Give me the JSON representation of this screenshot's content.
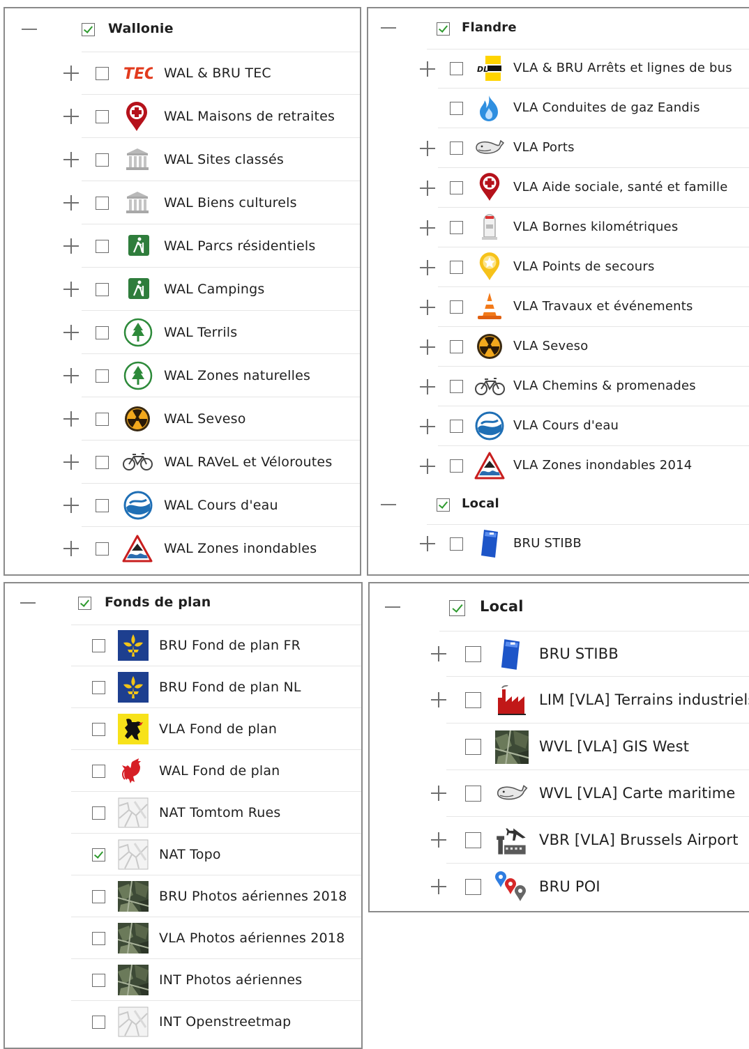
{
  "panels": {
    "wallonie": {
      "title": "Wallonie",
      "items": [
        {
          "label": "WAL & BRU TEC",
          "icon": "tec-logo-icon"
        },
        {
          "label": "WAL Maisons de retraites",
          "icon": "red-cross-marker-icon"
        },
        {
          "label": "WAL Sites classés",
          "icon": "monument-icon"
        },
        {
          "label": "WAL Biens culturels",
          "icon": "monument-icon"
        },
        {
          "label": "WAL Parcs résidentiels",
          "icon": "hiker-icon"
        },
        {
          "label": "WAL Campings",
          "icon": "hiker-icon"
        },
        {
          "label": "WAL Terrils",
          "icon": "tree-icon"
        },
        {
          "label": "WAL Zones naturelles",
          "icon": "tree-icon"
        },
        {
          "label": "WAL Seveso",
          "icon": "radiation-icon"
        },
        {
          "label": "WAL RAVeL et Véloroutes",
          "icon": "bicycle-icon"
        },
        {
          "label": "WAL Cours d'eau",
          "icon": "water-icon"
        },
        {
          "label": "WAL Zones inondables",
          "icon": "flood-warning-icon"
        }
      ]
    },
    "flandre": {
      "title": "Flandre",
      "items": [
        {
          "label": "VLA & BRU Arrêts et lignes de bus",
          "icon": "dl-bus-logo-icon",
          "expandable": true
        },
        {
          "label": "VLA Conduites de gaz Eandis",
          "icon": "gas-flame-icon",
          "expandable": false
        },
        {
          "label": "VLA Ports",
          "icon": "whale-icon",
          "expandable": true
        },
        {
          "label": "VLA Aide sociale, santé et famille",
          "icon": "red-cross-marker-icon",
          "expandable": true
        },
        {
          "label": "VLA Bornes kilométriques",
          "icon": "milestone-icon",
          "expandable": true
        },
        {
          "label": "VLA Points de secours",
          "icon": "rescue-point-icon",
          "expandable": true
        },
        {
          "label": "VLA Travaux et événements",
          "icon": "traffic-cone-icon",
          "expandable": true
        },
        {
          "label": "VLA Seveso",
          "icon": "radiation-icon",
          "expandable": true
        },
        {
          "label": "VLA Chemins & promenades",
          "icon": "bicycle-icon",
          "expandable": true
        },
        {
          "label": "VLA Cours d'eau",
          "icon": "water-icon",
          "expandable": true
        },
        {
          "label": "VLA Zones inondables 2014",
          "icon": "flood-warning-icon",
          "expandable": true
        }
      ],
      "local_title": "Local",
      "local_items": [
        {
          "label": "BRU STIBB",
          "icon": "stib-ticket-icon"
        }
      ]
    },
    "fonds": {
      "title": "Fonds de plan",
      "items": [
        {
          "label": "BRU Fond de plan FR",
          "icon": "brussels-iris-icon",
          "checked": false
        },
        {
          "label": "BRU Fond de plan NL",
          "icon": "brussels-iris-icon",
          "checked": false
        },
        {
          "label": "VLA Fond de plan",
          "icon": "flemish-lion-icon",
          "checked": false
        },
        {
          "label": "WAL Fond de plan",
          "icon": "walloon-rooster-icon",
          "checked": false
        },
        {
          "label": "NAT Tomtom Rues",
          "icon": "street-map-icon",
          "checked": false
        },
        {
          "label": "NAT Topo",
          "icon": "street-map-icon",
          "checked": true
        },
        {
          "label": "BRU Photos aériennes 2018",
          "icon": "aerial-photo-icon",
          "checked": false
        },
        {
          "label": "VLA Photos aériennes 2018",
          "icon": "aerial-photo-icon",
          "checked": false
        },
        {
          "label": "INT Photos aériennes",
          "icon": "aerial-photo-icon",
          "checked": false
        },
        {
          "label": "INT Openstreetmap",
          "icon": "street-map-icon",
          "checked": false
        }
      ]
    },
    "local": {
      "title": "Local",
      "items": [
        {
          "label": "BRU STIBB",
          "icon": "stib-ticket-icon",
          "expandable": true
        },
        {
          "label": "LIM [VLA] Terrains industriels",
          "icon": "factory-icon",
          "expandable": true
        },
        {
          "label": "WVL [VLA] GIS West",
          "icon": "aerial-photo-icon",
          "expandable": false
        },
        {
          "label": "WVL [VLA] Carte maritime",
          "icon": "whale-icon",
          "expandable": true
        },
        {
          "label": "VBR [VLA] Brussels Airport",
          "icon": "airport-icon",
          "expandable": true
        },
        {
          "label": "BRU POI",
          "icon": "poi-pins-icon",
          "expandable": true
        }
      ]
    }
  },
  "icon_text": {
    "tec": "TEC",
    "dl": "DL"
  },
  "colors": {
    "check_green": "#2e9a2e",
    "panel_border": "#8a8a8a",
    "separator": "#e6e6e6"
  }
}
